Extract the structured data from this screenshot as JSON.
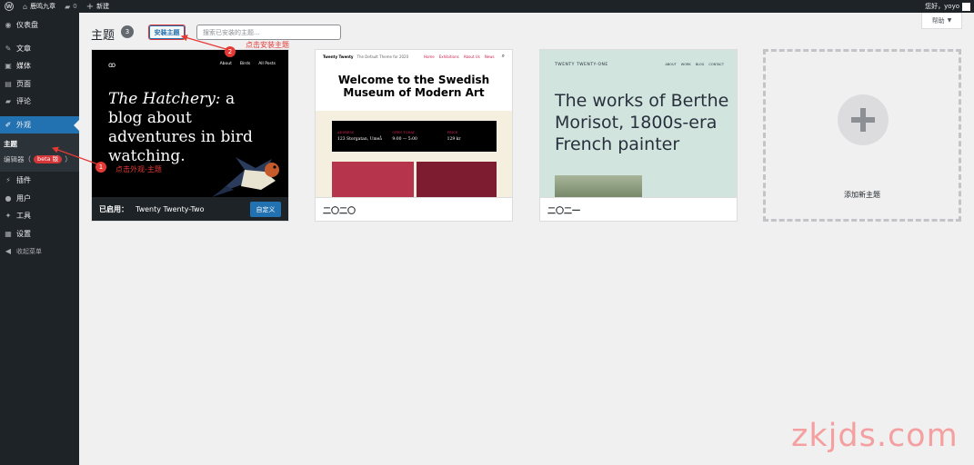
{
  "adminbar": {
    "site_name": "鹿鸣九章",
    "comments_count": "0",
    "new_label": "新建",
    "greeting": "您好，yoyo"
  },
  "sidebar": {
    "items": [
      {
        "label": "仪表盘",
        "icon": "dashboard-icon",
        "glyph": "◉"
      },
      {
        "label": "文章",
        "icon": "pin-icon",
        "glyph": "✎"
      },
      {
        "label": "媒体",
        "icon": "media-icon",
        "glyph": "▣"
      },
      {
        "label": "页面",
        "icon": "page-icon",
        "glyph": "▤"
      },
      {
        "label": "评论",
        "icon": "comment-icon",
        "glyph": "▰"
      },
      {
        "label": "外观",
        "icon": "brush-icon",
        "glyph": "✐"
      },
      {
        "label": "插件",
        "icon": "plugin-icon",
        "glyph": "⚡"
      },
      {
        "label": "用户",
        "icon": "user-icon",
        "glyph": "●"
      },
      {
        "label": "工具",
        "icon": "wrench-icon",
        "glyph": "✦"
      },
      {
        "label": "设置",
        "icon": "settings-icon",
        "glyph": "▦"
      },
      {
        "label": "收起菜单",
        "icon": "collapse-icon",
        "glyph": "◀"
      }
    ],
    "submenu": {
      "themes": "主题",
      "editor": "编辑器（",
      "beta": "beta 版",
      "editor_close": "）"
    }
  },
  "help_tab": {
    "label": "帮助"
  },
  "header": {
    "title": "主题",
    "count": "3",
    "install_button": "安装主题",
    "search_placeholder": "搜索已安装的主题..."
  },
  "themes": [
    {
      "name": "Twenty Twenty-Two",
      "active_label": "已启用：",
      "customize_label": "自定义",
      "preview": {
        "logo": "ꝏ",
        "nav": [
          "About",
          "Birds",
          "All Posts"
        ],
        "tagline_em": "The Hatchery:",
        "tagline_rest": " a blog about adventures in bird watching."
      }
    },
    {
      "name": "二〇二〇",
      "preview": {
        "brand": "Twenty Twenty",
        "desc": "The Default Theme for 2020",
        "nav": [
          "Home",
          "Exhibitions",
          "About Us",
          "News"
        ],
        "hero": "Welcome to the Swedish Museum of Modern Art",
        "info": [
          {
            "label": "ADDRESS",
            "value": "123 Storgatan, Umeå"
          },
          {
            "label": "OPEN TODAY",
            "value": "9:00 — 5:00"
          },
          {
            "label": "PRICE",
            "value": "129 kr"
          }
        ]
      }
    },
    {
      "name": "二〇二一",
      "preview": {
        "site": "TWENTY TWENTY-ONE",
        "nav": [
          "ABOUT",
          "WORK",
          "BLOG",
          "CONTACT"
        ],
        "hero": "The works of Berthe Morisot, 1800s-era French painter"
      }
    }
  ],
  "add_new": {
    "label": "添加新主题"
  },
  "annotations": [
    {
      "number": "1",
      "text": "点击外观-主题"
    },
    {
      "number": "2",
      "text": "点击安装主题"
    }
  ],
  "watermark": "zkjds.com",
  "colors": {
    "accent": "#2271b1",
    "admin_dark": "#1d2327",
    "annotation": "#e53935"
  }
}
